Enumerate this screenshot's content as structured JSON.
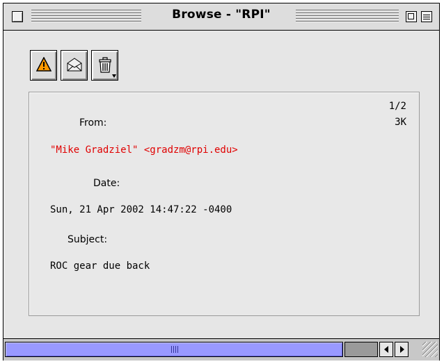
{
  "window": {
    "title": "Browse - \"RPI\""
  },
  "toolbar": {
    "buttons": [
      {
        "name": "warning",
        "icon": "warning-icon"
      },
      {
        "name": "open-mail",
        "icon": "envelope-icon"
      },
      {
        "name": "delete",
        "icon": "trash-icon"
      }
    ]
  },
  "message": {
    "count": "1/2",
    "size": "3K",
    "from_label": "From:",
    "from_value": "\"Mike Gradziel\" <gradzm@rpi.edu>",
    "date_label": "Date:",
    "date_value": "Sun, 21 Apr 2002 14:47:22 -0400",
    "subject_label": "Subject:",
    "subject_value": "ROC gear due back"
  },
  "colors": {
    "from_text": "#e00000",
    "scrollbar": "#9999ff",
    "warning": "#ff9900"
  }
}
